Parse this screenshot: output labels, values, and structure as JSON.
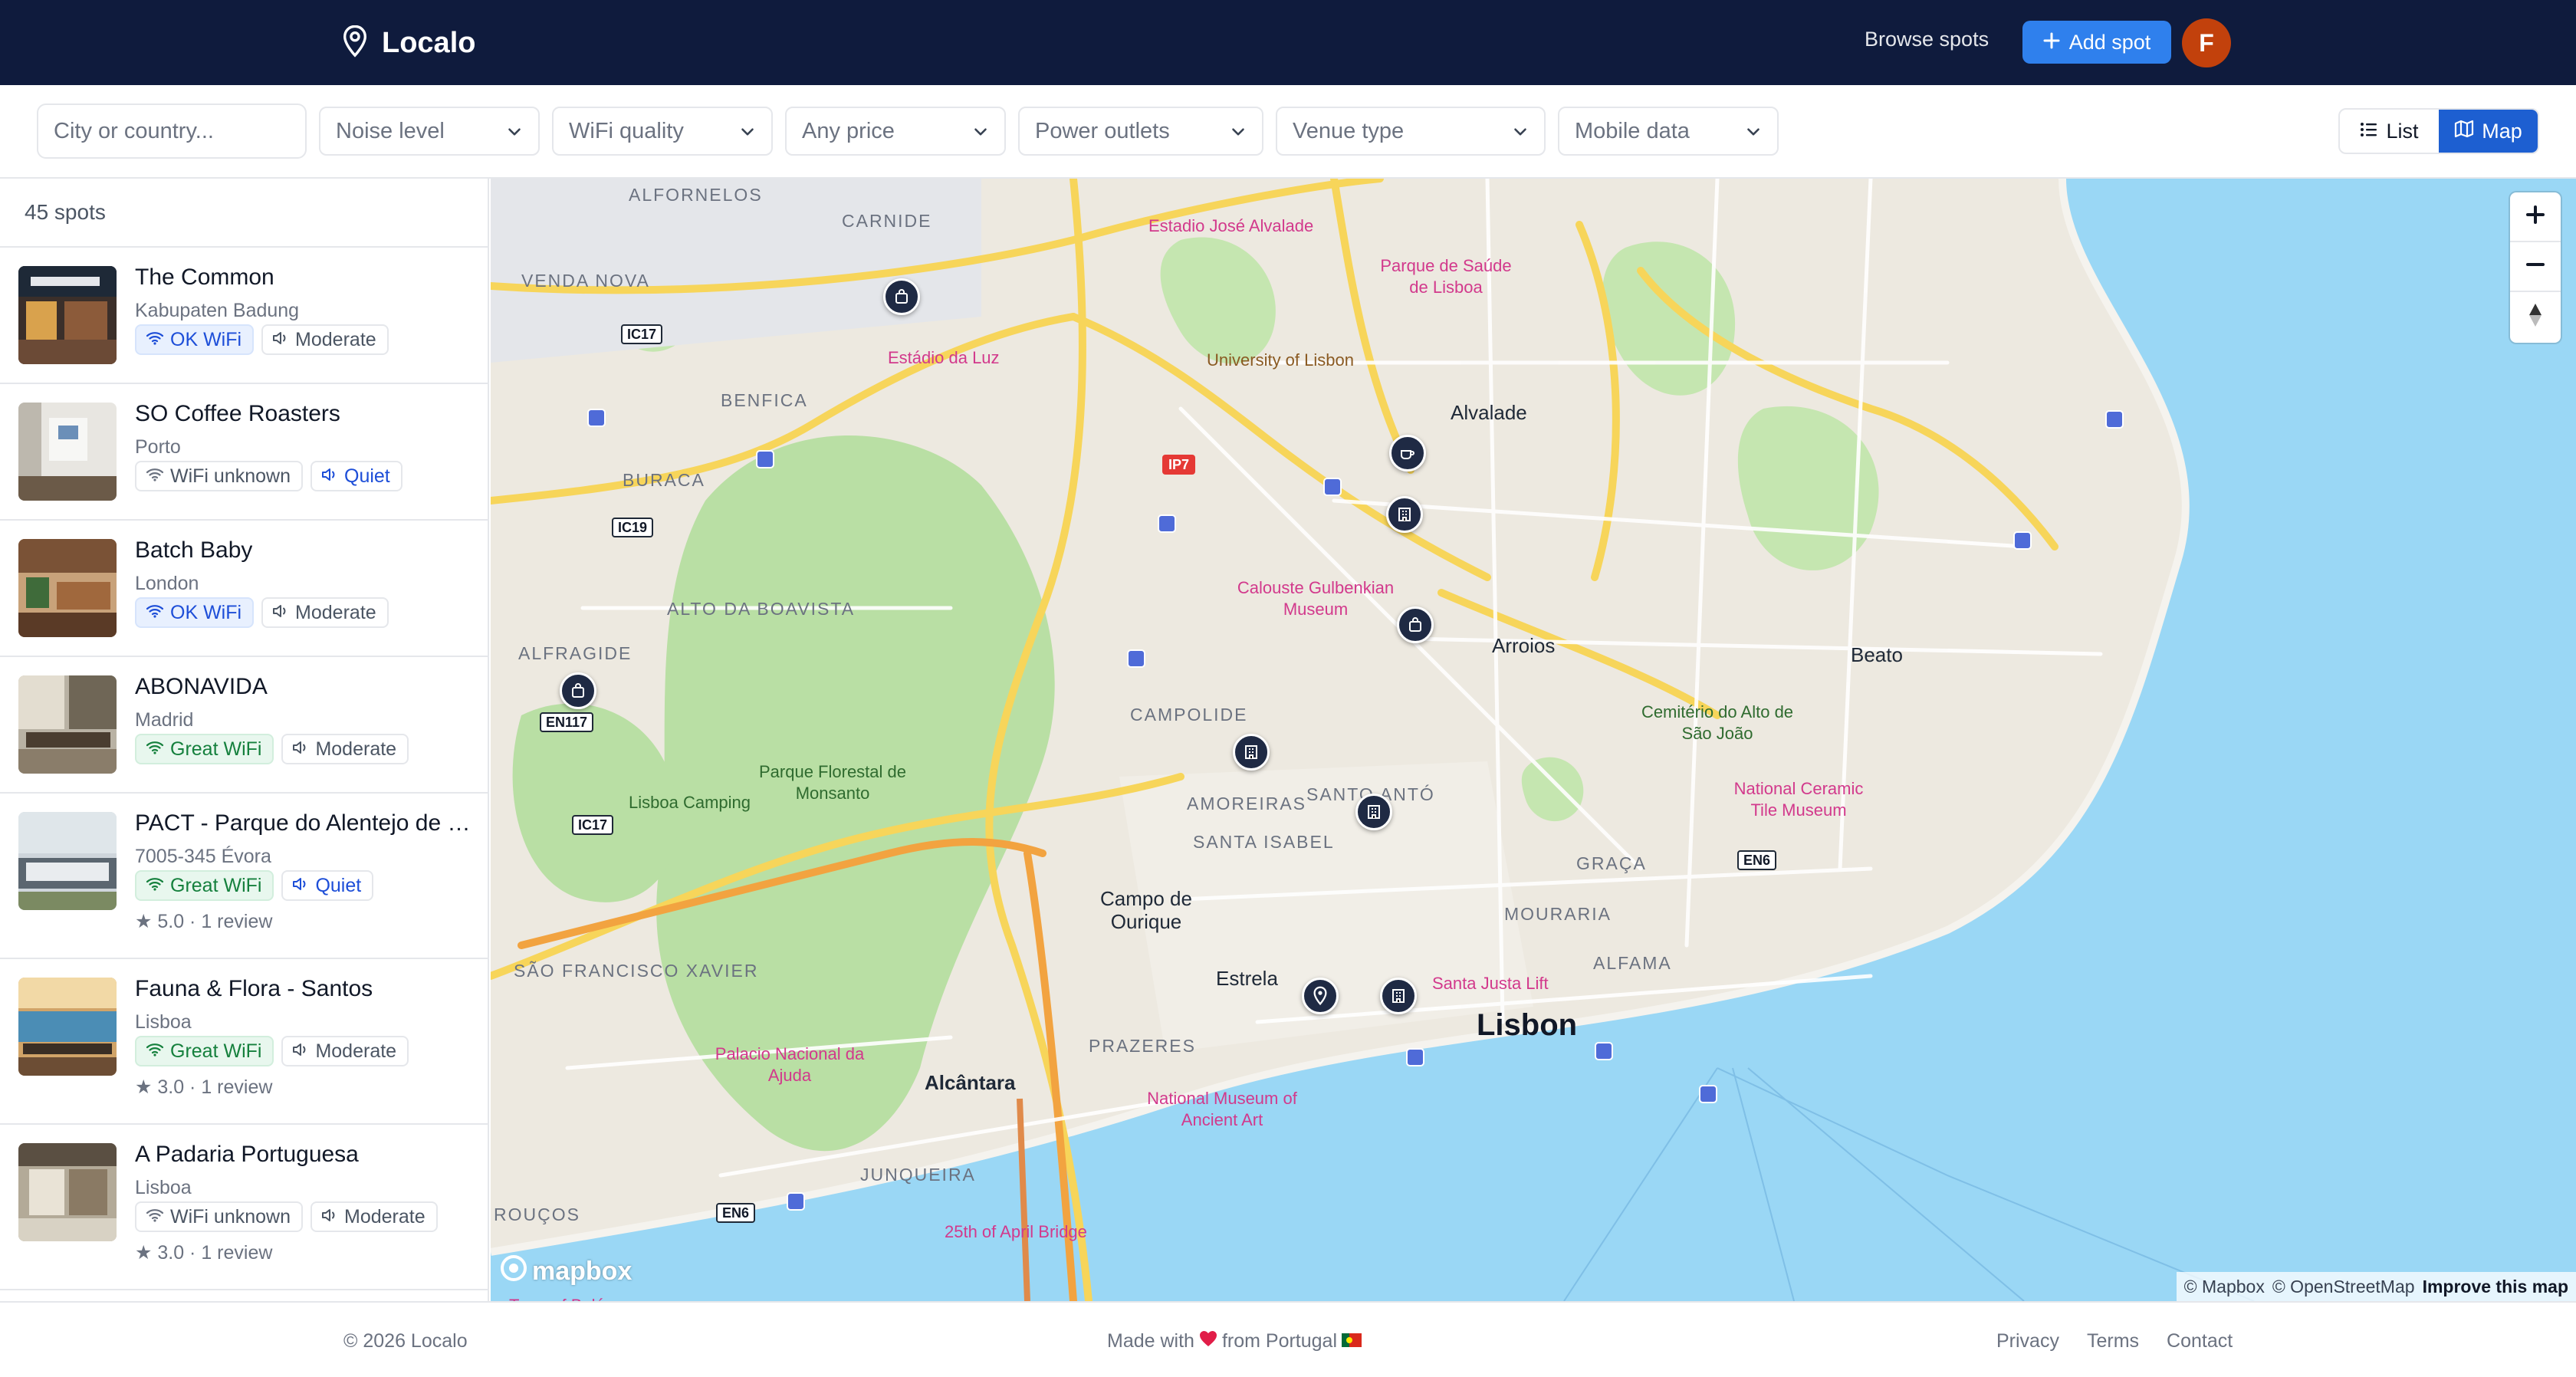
{
  "app": {
    "name": "Localo",
    "avatar_initial": "F"
  },
  "header": {
    "browse_label": "Browse spots",
    "add_label": "Add spot"
  },
  "filters": {
    "search_placeholder": "City or country...",
    "selects": [
      {
        "label": "Noise level"
      },
      {
        "label": "WiFi quality"
      },
      {
        "label": "Any price"
      },
      {
        "label": "Power outlets"
      },
      {
        "label": "Venue type"
      },
      {
        "label": "Mobile data"
      }
    ],
    "view": {
      "list_label": "List",
      "map_label": "Map",
      "active": "Map"
    }
  },
  "sidebar": {
    "count_label": "45 spots",
    "spots": [
      {
        "name": "The Common",
        "location": "Kabupaten Badung",
        "wifi": "OK WiFi",
        "wifi_level": "ok",
        "noise": "Moderate",
        "noise_level": "moderate",
        "rating": ""
      },
      {
        "name": "SO Coffee Roasters",
        "location": "Porto",
        "wifi": "WiFi unknown",
        "wifi_level": "unknown",
        "noise": "Quiet",
        "noise_level": "quiet",
        "rating": ""
      },
      {
        "name": "Batch Baby",
        "location": "London",
        "wifi": "OK WiFi",
        "wifi_level": "ok",
        "noise": "Moderate",
        "noise_level": "moderate",
        "rating": ""
      },
      {
        "name": "ABONAVIDA",
        "location": "Madrid",
        "wifi": "Great WiFi",
        "wifi_level": "great",
        "noise": "Moderate",
        "noise_level": "moderate",
        "rating": ""
      },
      {
        "name": "PACT - Parque do Alentejo de Ciência e Tecnologia",
        "location": "7005-345 Évora",
        "wifi": "Great WiFi",
        "wifi_level": "great",
        "noise": "Quiet",
        "noise_level": "quiet",
        "rating": "5.0 · 1 review"
      },
      {
        "name": "Fauna & Flora - Santos",
        "location": "Lisboa",
        "wifi": "Great WiFi",
        "wifi_level": "great",
        "noise": "Moderate",
        "noise_level": "moderate",
        "rating": "3.0 · 1 review"
      },
      {
        "name": "A Padaria Portuguesa",
        "location": "Lisboa",
        "wifi": "WiFi unknown",
        "wifi_level": "unknown",
        "noise": "Moderate",
        "noise_level": "moderate",
        "rating": "3.0 · 1 review"
      }
    ]
  },
  "map": {
    "city_label": "Lisbon",
    "neighborhoods": [
      "Alvalade",
      "Arroios",
      "Beato",
      "Estrela",
      "Alcântara",
      "Campo de Ourique"
    ],
    "districts": [
      "ALFORNELOS",
      "CARNIDE",
      "VENDA NOVA",
      "BENFICA",
      "BURACA",
      "ALTO DA BOAVISTA",
      "ALFRAGIDE",
      "CAMPOLIDE",
      "AMOREIRAS",
      "SANTA ISABEL",
      "SANTO ANTÓ",
      "SÃO FRANCISCO XAVIER",
      "PRAZERES",
      "JUNQUEIRA",
      "MOURARIA",
      "GRAÇA",
      "ALFAMA",
      "ROUÇOS"
    ],
    "pois": [
      "Estadio José Alvalade",
      "Parque de Saúde de Lisboa",
      "Estádio da Luz",
      "University of Lisbon",
      "Calouste Gulbenkian Museum",
      "Parque Florestal de Monsanto",
      "Lisboa Camping",
      "Cemitério do Alto de São João",
      "National Ceramic Tile Museum",
      "Santa Justa Lift",
      "Palacio Nacional da Ajuda",
      "National Museum of Ancient Art",
      "25th of April Bridge",
      "Torre of Belém"
    ],
    "road_shields": [
      "IC17",
      "IC19",
      "IP7",
      "EN117",
      "IC17",
      "EN6",
      "EN6"
    ],
    "pin_icons": [
      "bag-icon",
      "coffee-icon",
      "building-icon",
      "bag-icon",
      "bag-icon",
      "building-icon",
      "building-icon",
      "location-icon",
      "building-icon"
    ],
    "attribution": {
      "mapbox": "© Mapbox",
      "osm": "© OpenStreetMap",
      "improve": "Improve this map"
    },
    "logo_text": "mapbox",
    "colors": {
      "water": "#9ad7f5",
      "land": "#ede9e0",
      "park": "#b9dfa4",
      "major_road": "#f7d55a"
    }
  },
  "footer": {
    "copyright": "© 2026 Localo",
    "made_with": "Made with",
    "made_from": "from Portugal",
    "links": [
      "Privacy",
      "Terms",
      "Contact"
    ]
  }
}
